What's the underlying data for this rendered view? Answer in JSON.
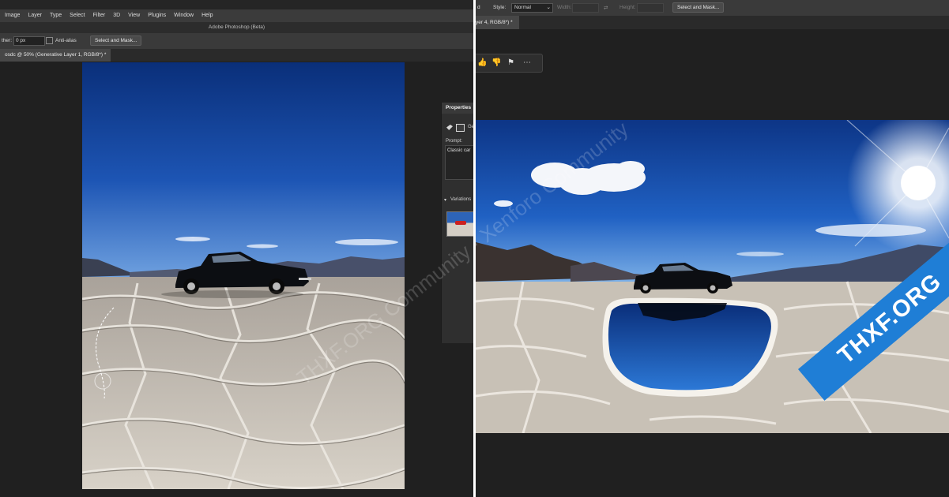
{
  "left": {
    "menu": [
      "Image",
      "Layer",
      "Type",
      "Select",
      "Filter",
      "3D",
      "View",
      "Plugins",
      "Window",
      "Help"
    ],
    "app_title": "Adobe Photoshop (Beta)",
    "options": {
      "feather_label": "ther:",
      "feather_value": "0 px",
      "anti_alias_label": "Anti-alias",
      "select_mask_label": "Select and Mask..."
    },
    "document_tab": "osdc @ 50% (Generative Layer 1, RGB/8*) *",
    "properties": {
      "title": "Properties",
      "layer_label": "Ge",
      "prompt_label": "Prompt:",
      "prompt_value": "Classic car",
      "variations_label": "Variations"
    }
  },
  "right": {
    "options": {
      "prefix": "d",
      "style_label": "Style:",
      "style_value": "Normal",
      "width_label": "Width:",
      "height_label": "Height:",
      "select_mask_label": "Select and Mask..."
    },
    "document_tab": "yer 4, RGB/8*) *",
    "feedback_icons": [
      "thumbs-up-icon",
      "thumbs-down-icon",
      "flag-icon",
      "more-icon"
    ]
  },
  "overlay": {
    "watermark": "THXF.ORG Community · Xenforo Community",
    "logo": "THXF.ORG"
  },
  "colors": {
    "ui_dark": "#252525",
    "menubar": "#3b3b3b",
    "sky": "#1a4fa8",
    "logo_blue": "#1f7ed6"
  }
}
